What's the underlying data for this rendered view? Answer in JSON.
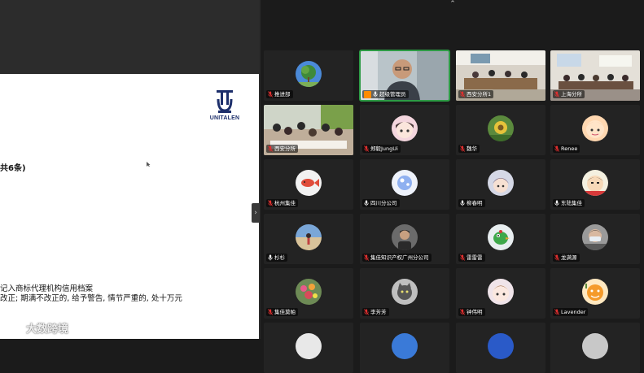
{
  "slide": {
    "logo_text": "UNITALEN",
    "heading": "共6条)",
    "line_1": "记入商标代理机构信用档案",
    "line_2": "改正; 期满不改正的, 给予警告, 情节严重的, 处十万元",
    "watermark": "大数跨境"
  },
  "gallery": {
    "tiles": [
      {
        "name": "推进部",
        "kind": "avatar",
        "avatar": "tree",
        "muted": true
      },
      {
        "name": "超级管理员",
        "kind": "video",
        "scene": "person",
        "host": true,
        "muted": false,
        "active": true
      },
      {
        "name": "西安分所1",
        "kind": "video",
        "scene": "meeting",
        "muted": true
      },
      {
        "name": "上海分所",
        "kind": "video",
        "scene": "office",
        "muted": true
      },
      {
        "name": "西安分所",
        "kind": "video",
        "scene": "group",
        "muted": true
      },
      {
        "name": "郑毅JungUi",
        "kind": "avatar",
        "avatar": "anime-girl",
        "muted": true
      },
      {
        "name": "魏华",
        "kind": "avatar",
        "avatar": "sunflower",
        "muted": true
      },
      {
        "name": "Renee",
        "kind": "avatar",
        "avatar": "cartoon-face",
        "muted": true
      },
      {
        "name": "杭州集佳",
        "kind": "avatar",
        "avatar": "fish",
        "muted": true
      },
      {
        "name": "四川分公司",
        "kind": "avatar",
        "avatar": "bubble",
        "muted": false
      },
      {
        "name": "柳春明",
        "kind": "avatar",
        "avatar": "anime-boy",
        "muted": false
      },
      {
        "name": "东陆集佳",
        "kind": "avatar",
        "avatar": "crayon",
        "muted": false
      },
      {
        "name": "杉杉",
        "kind": "avatar",
        "avatar": "beach",
        "muted": false
      },
      {
        "name": "集佳知识产权广州分公司",
        "kind": "avatar",
        "avatar": "man-photo",
        "muted": true
      },
      {
        "name": "雷雷雷",
        "kind": "avatar",
        "avatar": "green-bird",
        "muted": true
      },
      {
        "name": "龙满源",
        "kind": "avatar",
        "avatar": "masked-face",
        "muted": true
      },
      {
        "name": "集佳莫帕",
        "kind": "avatar",
        "avatar": "flowers",
        "muted": true
      },
      {
        "name": "李芳芳",
        "kind": "avatar",
        "avatar": "cat",
        "muted": true
      },
      {
        "name": "钟伟明",
        "kind": "avatar",
        "avatar": "anime-face",
        "muted": true
      },
      {
        "name": "Lavender",
        "kind": "avatar",
        "avatar": "orange-cartoon",
        "muted": true
      }
    ]
  },
  "colors": {
    "gallery_bg": "#1b1b1b",
    "tile_bg": "#232323",
    "active_border": "#2d9b45",
    "host_badge": "#ff8a00",
    "mic_muted": "#e02f2f"
  }
}
